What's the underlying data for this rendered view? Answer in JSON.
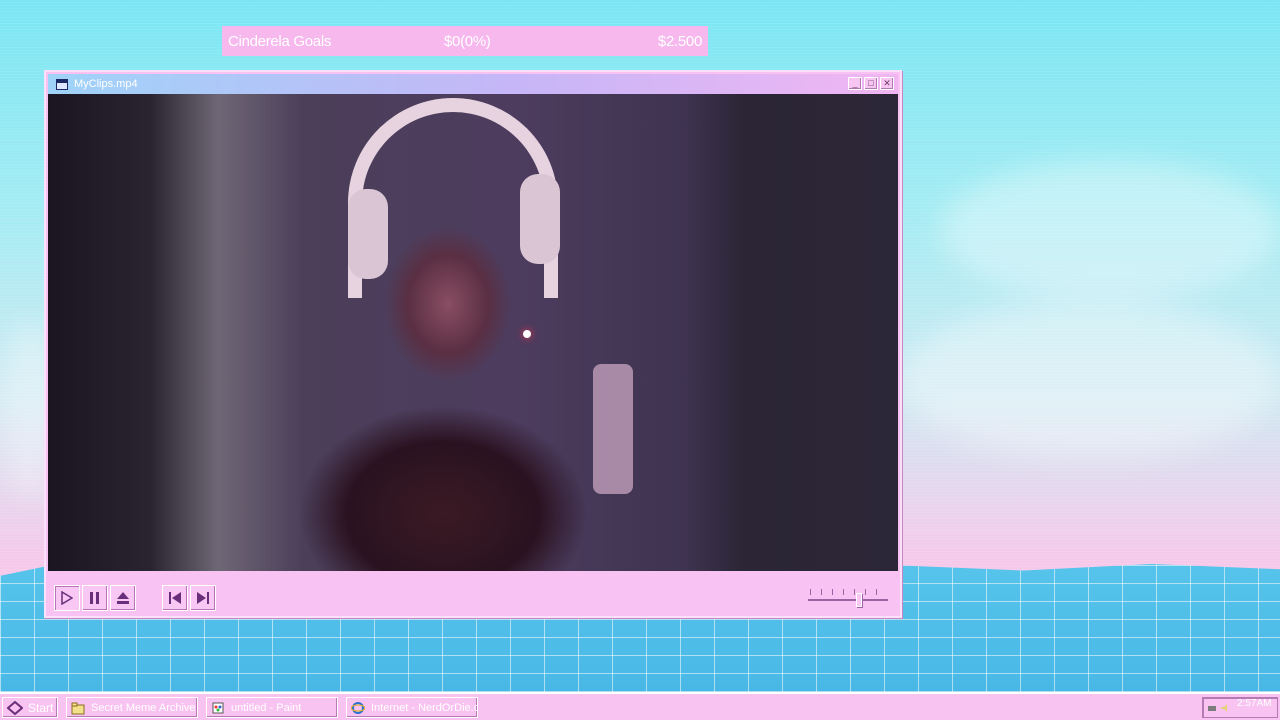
{
  "goal": {
    "title": "Cinderela Goals",
    "progress_text": "$0(0%)",
    "target": "$2.500",
    "progress_fraction": 0
  },
  "window": {
    "title": "MyClips.mp4",
    "minimize_icon": "minimize-icon",
    "maximize_icon": "maximize-icon",
    "close_icon": "close-icon"
  },
  "player": {
    "controls": [
      "play-icon",
      "pause-icon",
      "eject-icon",
      "previous-icon",
      "next-icon"
    ],
    "volume_level": 0.65
  },
  "taskbar": {
    "start_label": "Start",
    "tasks": [
      {
        "label": "Secret Meme Archive",
        "icon": "folder-icon"
      },
      {
        "label": "untitled - Paint",
        "icon": "paint-icon"
      },
      {
        "label": "Internet - NerdOrDie.com",
        "icon": "internet-explorer-icon"
      }
    ],
    "clock": "2:57AM"
  },
  "colors": {
    "accent_pink": "#f9c3f1",
    "sky_cyan": "#7ae6f3",
    "titlebar_blue": "#9fd3f8"
  }
}
